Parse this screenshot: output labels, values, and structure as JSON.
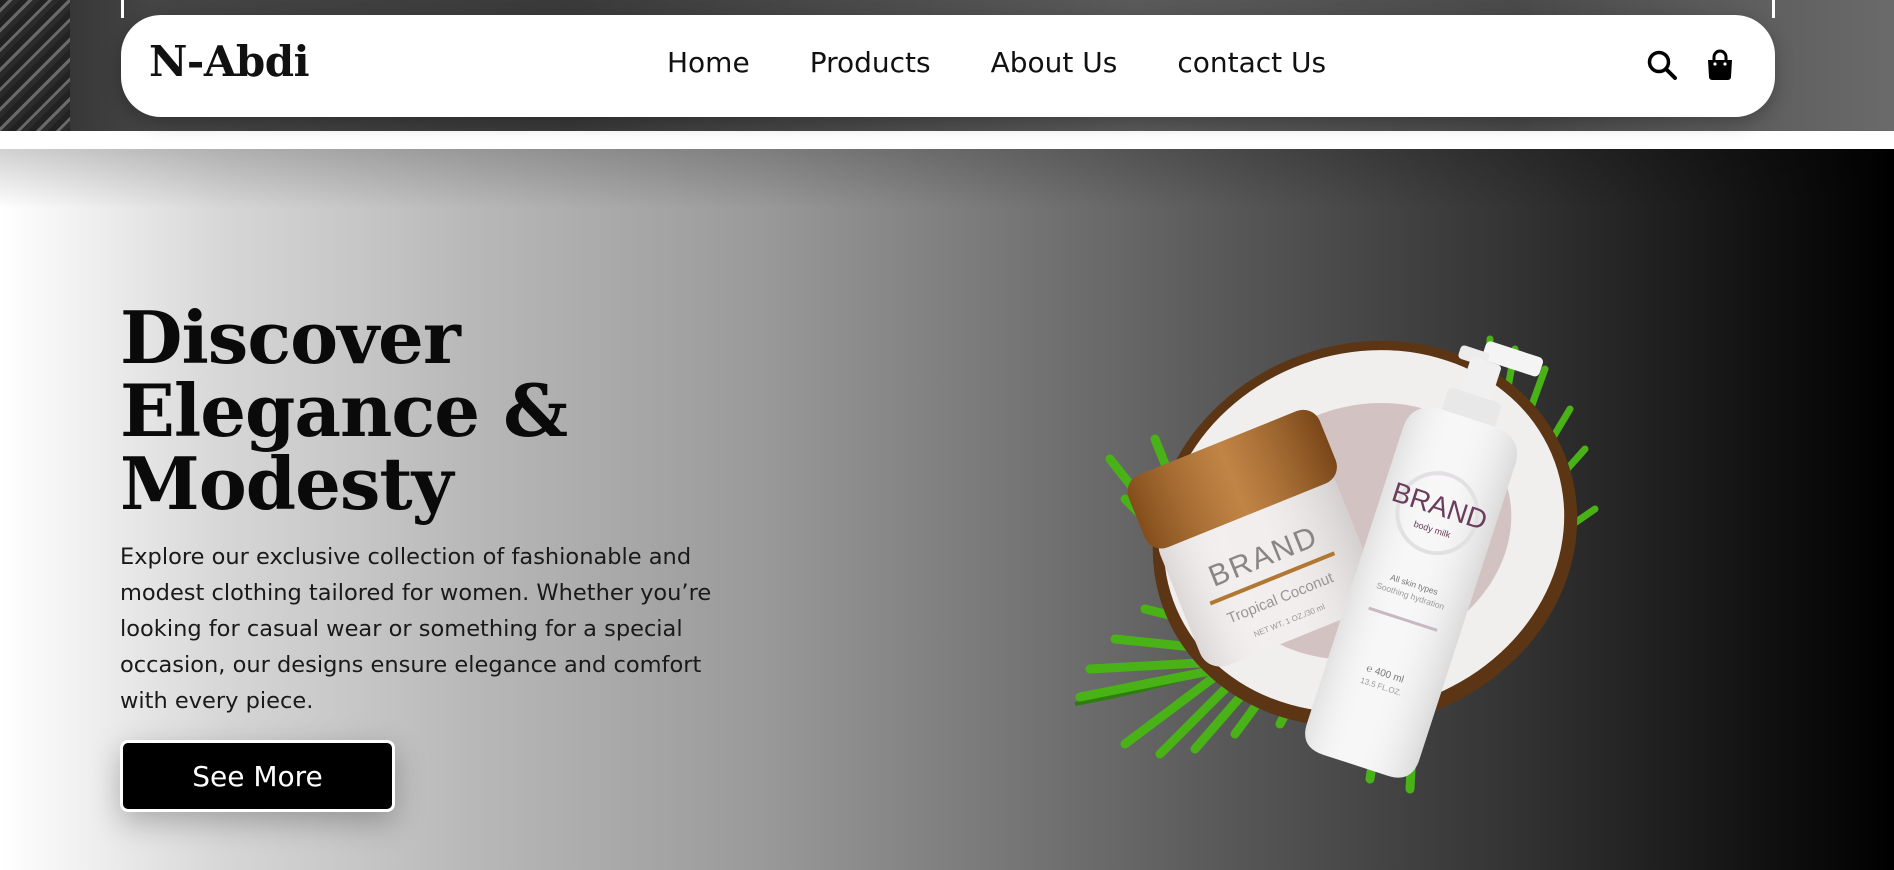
{
  "nav": {
    "brand": "N-Abdi",
    "links": [
      "Home",
      "Products",
      "About Us",
      "contact Us"
    ],
    "icons": [
      "search-icon",
      "shopping-bag-icon"
    ]
  },
  "hero": {
    "title_lines": [
      "Discover",
      "Elegance &",
      "Modesty"
    ],
    "description": "Explore our exclusive collection of fashionable and modest clothing tailored for women. Whether you’re looking for casual wear or something for a special occasion, our designs ensure elegance and comfort with every piece.",
    "cta_label": "See More"
  },
  "product_image": {
    "jar": {
      "brand": "BRAND",
      "name": "Tropical Coconut",
      "net": "NET WT. 1 OZ./30 ml"
    },
    "bottle": {
      "brand": "BRAND",
      "subtitle": "body milk",
      "line1": "All skin types",
      "line2": "Soothing hydration",
      "volume": "℮ 400 ml",
      "volume_oz": "13.5 FL.OZ."
    }
  },
  "colors": {
    "accent": "#000000",
    "nav_bg": "#ffffff",
    "text": "#111111",
    "jar_lid": "#a8682a",
    "bottle_text": "#6b3d5c",
    "leaf": "#3aa10f"
  }
}
